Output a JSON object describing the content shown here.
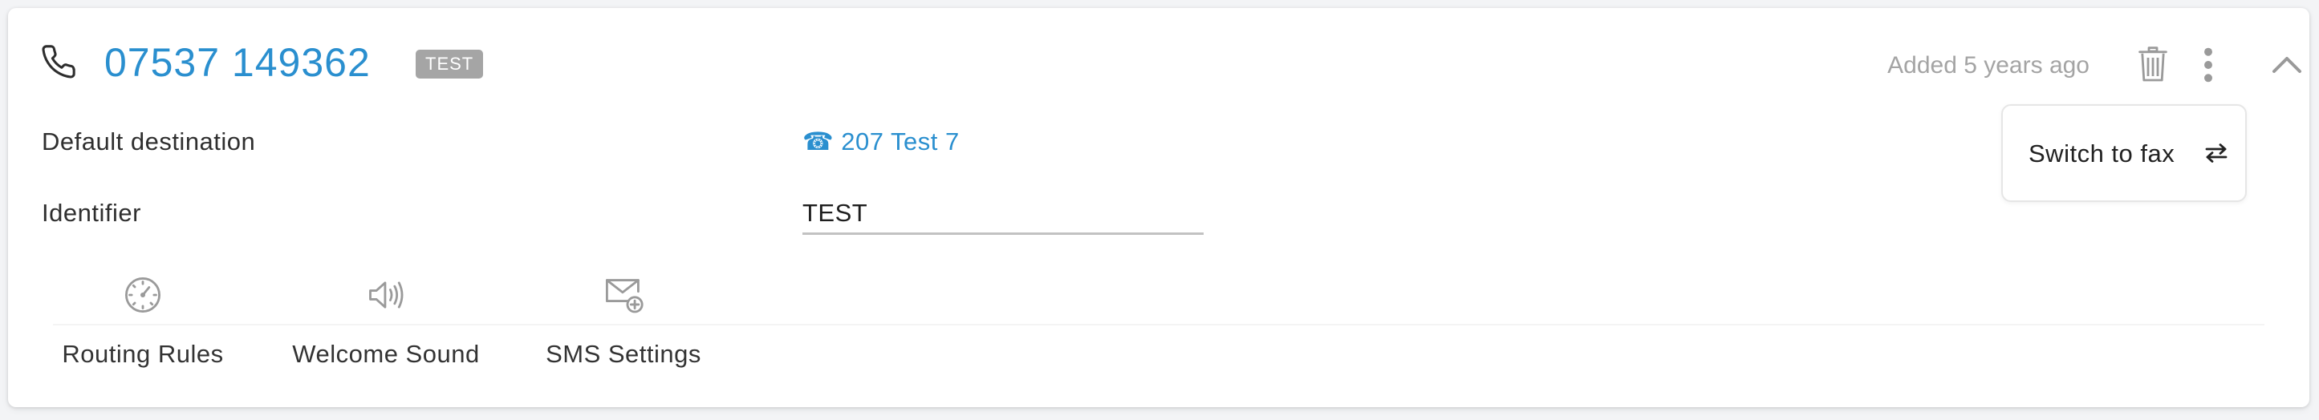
{
  "header": {
    "phone_icon": "phone-icon",
    "number": "07537 149362",
    "tag": "TEST",
    "added": "Added 5 years ago",
    "trash_icon": "trash-icon",
    "more_icon": "vertical-dots-icon",
    "collapse_icon": "chevron-up-icon"
  },
  "fields": {
    "default_destination": {
      "label": "Default destination",
      "value": "☎ 207 Test 7"
    },
    "identifier": {
      "label": "Identifier",
      "value": "TEST"
    }
  },
  "menu": {
    "switch_label": "Switch to fax",
    "switch_icon": "swap-arrows-icon"
  },
  "features": [
    {
      "label": "Routing Rules",
      "icon": "clock-dial-icon"
    },
    {
      "label": "Welcome Sound",
      "icon": "speaker-icon"
    },
    {
      "label": "SMS Settings",
      "icon": "envelope-plus-icon"
    }
  ],
  "colors": {
    "accent": "#2a8fcf",
    "tag_bg": "#a5a5a5",
    "muted_text": "#a4a4a4",
    "icon_gray": "#9a9a9a"
  }
}
